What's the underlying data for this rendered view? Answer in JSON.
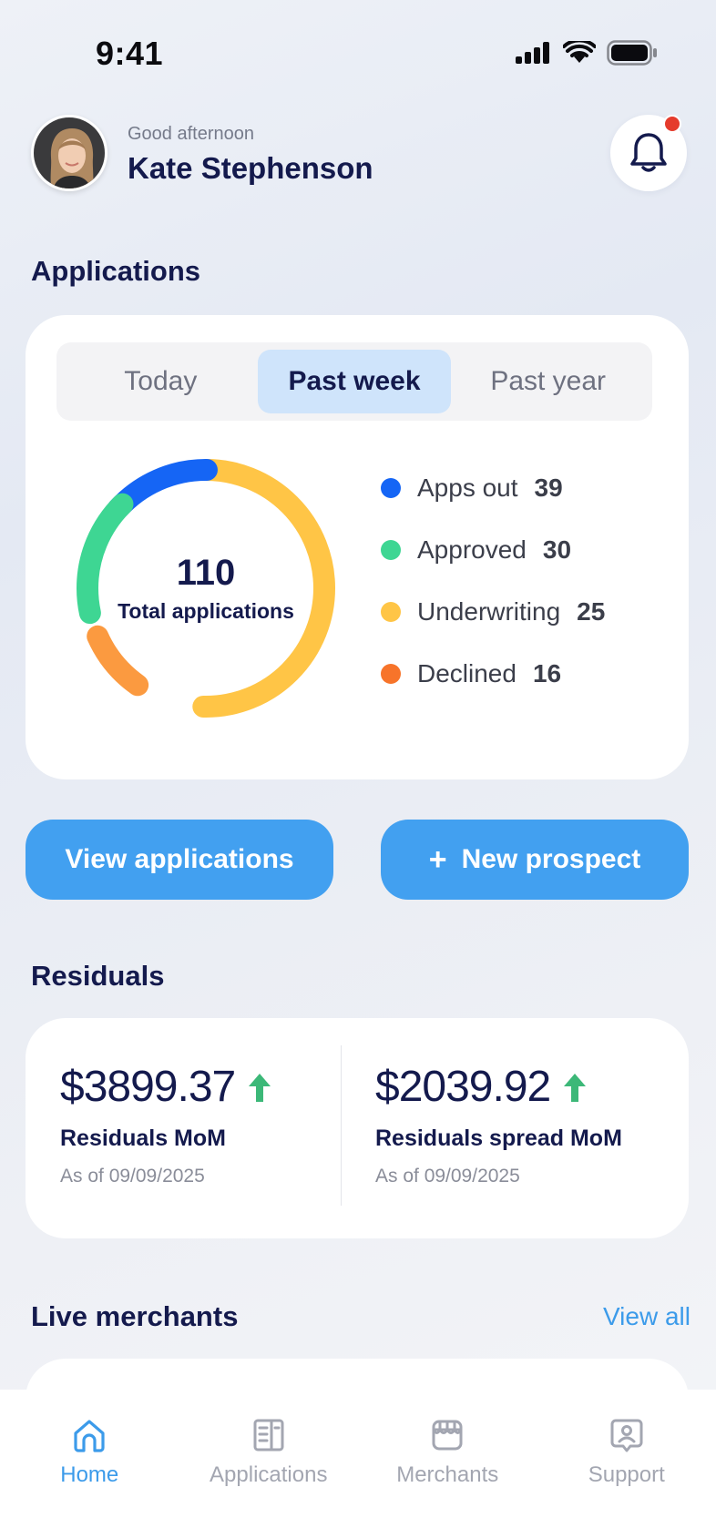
{
  "status_bar": {
    "time": "9:41"
  },
  "header": {
    "greeting": "Good afternoon",
    "name": "Kate Stephenson"
  },
  "applications": {
    "title": "Applications",
    "tabs": [
      "Today",
      "Past week",
      "Past year"
    ],
    "active_tab": "Past week",
    "total": "110",
    "total_label": "Total applications",
    "legend": [
      {
        "label": "Apps out",
        "value": "39",
        "color": "#1565f5"
      },
      {
        "label": "Approved",
        "value": "30",
        "color": "#3ed693"
      },
      {
        "label": "Underwriting",
        "value": "25",
        "color": "#ffc546"
      },
      {
        "label": "Declined",
        "value": "16",
        "color": "#f7742a"
      }
    ]
  },
  "actions": {
    "view_applications": "View applications",
    "new_prospect_plus": "+",
    "new_prospect": "New prospect"
  },
  "residuals": {
    "title": "Residuals",
    "items": [
      {
        "amount": "$3899.37",
        "label": "Residuals MoM",
        "date": "As of 09/09/2025"
      },
      {
        "amount": "$2039.92",
        "label": "Residuals spread MoM",
        "date": "As of 09/09/2025"
      }
    ],
    "up_color": "#3cb878"
  },
  "live_merchants": {
    "title": "Live merchants",
    "view_all": "View all"
  },
  "tab_bar": {
    "items": [
      {
        "label": "Home",
        "icon": "home-icon",
        "active": true
      },
      {
        "label": "Applications",
        "icon": "document-icon",
        "active": false
      },
      {
        "label": "Merchants",
        "icon": "store-icon",
        "active": false
      },
      {
        "label": "Support",
        "icon": "support-icon",
        "active": false
      }
    ]
  },
  "colors": {
    "accent": "#42a0f0",
    "navy": "#141a4d",
    "notification": "#e53b2c"
  }
}
